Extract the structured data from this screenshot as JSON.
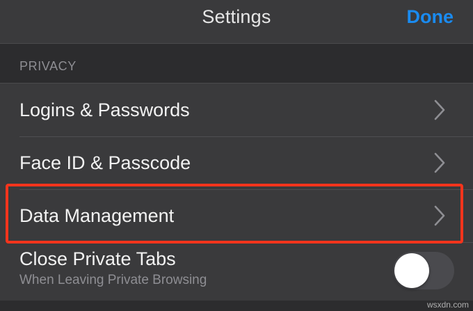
{
  "navbar": {
    "title": "Settings",
    "done_label": "Done"
  },
  "section": {
    "header": "PRIVACY"
  },
  "rows": [
    {
      "label": "Logins & Passwords",
      "icon": "chevron-right-icon"
    },
    {
      "label": "Face ID & Passcode",
      "icon": "chevron-right-icon"
    },
    {
      "label": "Data Management",
      "icon": "chevron-right-icon"
    }
  ],
  "toggle_row": {
    "label": "Close Private Tabs",
    "sublabel": "When Leaving Private Browsing",
    "enabled": false
  },
  "watermark": "wsxdn.com",
  "colors": {
    "accent": "#1a8bf0",
    "highlight": "#f4341c",
    "background": "#2c2c2e",
    "cell": "#3a3a3c"
  }
}
